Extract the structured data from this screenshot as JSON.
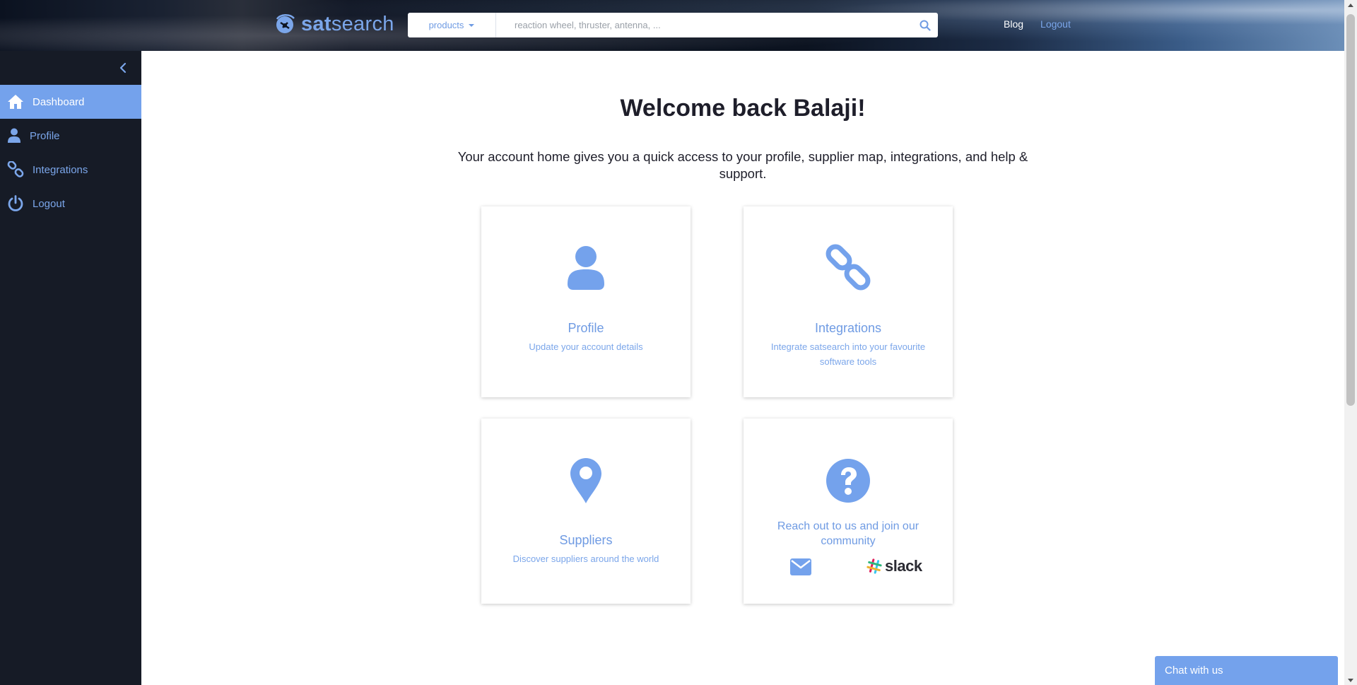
{
  "header": {
    "logo_prefix": "sat",
    "logo_suffix": "search",
    "search_type": "products",
    "search_placeholder": "reaction wheel, thruster, antenna, ...",
    "links": {
      "blog": "Blog",
      "logout": "Logout"
    }
  },
  "sidebar": {
    "items": [
      {
        "label": "Dashboard",
        "icon": "home-icon",
        "active": true
      },
      {
        "label": "Profile",
        "icon": "user-icon",
        "active": false
      },
      {
        "label": "Integrations",
        "icon": "link-icon",
        "active": false
      },
      {
        "label": "Logout",
        "icon": "power-icon",
        "active": false
      }
    ]
  },
  "main": {
    "welcome": "Welcome back Balaji!",
    "intro": "Your account home gives you a quick access to your profile, supplier map, integrations, and help & support.",
    "cards": [
      {
        "title": "Profile",
        "desc": "Update your account details",
        "icon": "user-icon"
      },
      {
        "title": "Integrations",
        "desc": "Integrate satsearch into your favourite software tools",
        "icon": "link-icon"
      },
      {
        "title": "Suppliers",
        "desc": "Discover suppliers around the world",
        "icon": "map-marker-icon"
      },
      {
        "title": "Reach out to us and join our community",
        "icon": "question-circle-icon",
        "slack_label": "slack"
      }
    ]
  },
  "chat": {
    "label": "Chat with us"
  },
  "colors": {
    "accent": "#74a2ec",
    "link": "#7ba6ea",
    "sidebar_bg": "#161b26"
  }
}
